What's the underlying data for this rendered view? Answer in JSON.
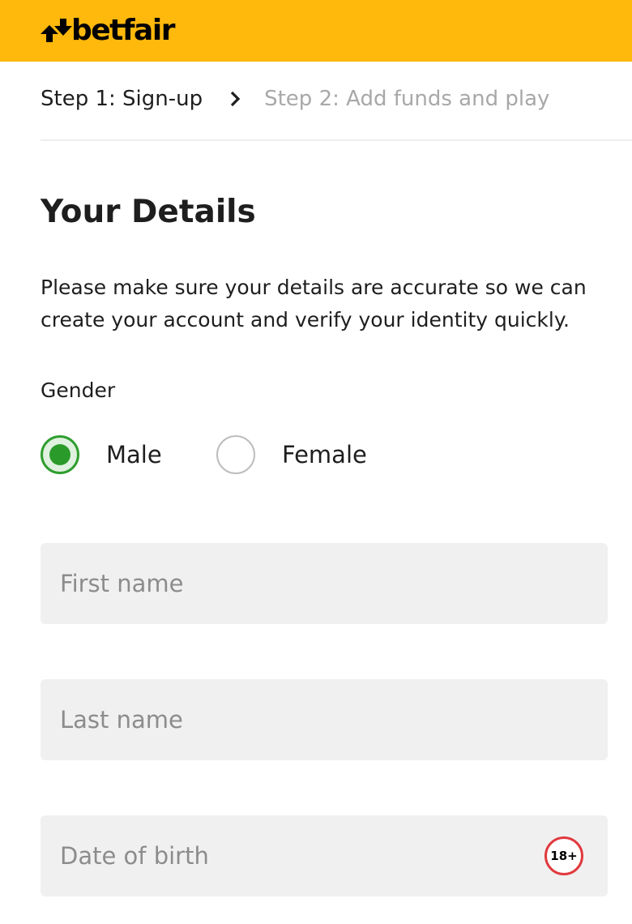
{
  "header": {
    "logo_text": "betfair",
    "logo_icon": "betfair-arrows-logo",
    "background_color": "#ffb80c"
  },
  "steps": {
    "current": "Step 1: Sign-up",
    "separator_icon": "chevron-right-icon",
    "next": "Step 2: Add funds and play"
  },
  "page": {
    "title": "Your Details",
    "intro": "Please make sure your details are accurate so we can create your account and verify your identity quickly."
  },
  "gender": {
    "label": "Gender",
    "selected": "Male",
    "options": [
      {
        "label": "Male",
        "checked": true
      },
      {
        "label": "Female",
        "checked": false
      }
    ],
    "accent_color": "#2a9b2a"
  },
  "form": {
    "first_name": {
      "placeholder": "First name",
      "value": ""
    },
    "last_name": {
      "placeholder": "Last name",
      "value": ""
    },
    "date_of_birth": {
      "placeholder": "Date of birth",
      "value": "",
      "badge": "18+"
    }
  }
}
